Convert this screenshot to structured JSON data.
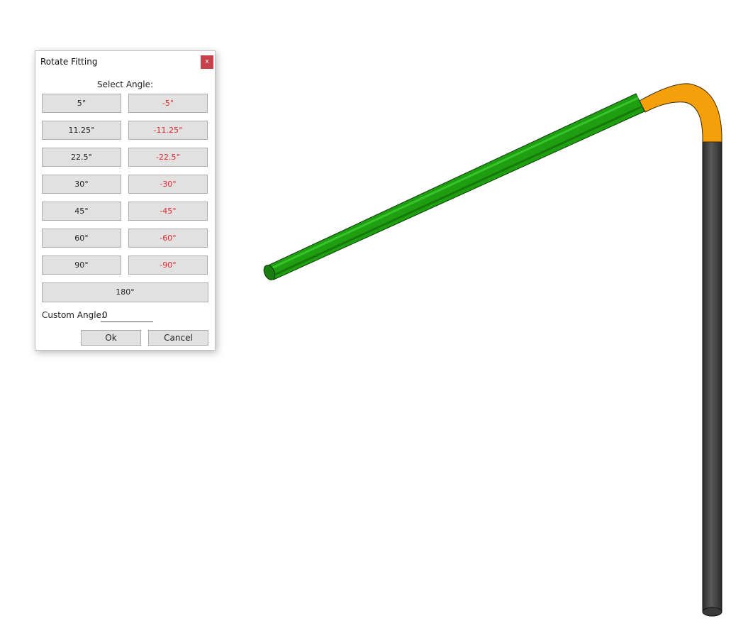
{
  "dialog": {
    "title": "Rotate Fitting",
    "close_label": "x",
    "select_label": "Select Angle:",
    "angles": [
      {
        "pos": "5°",
        "neg": "-5°"
      },
      {
        "pos": "11.25°",
        "neg": "-11.25°"
      },
      {
        "pos": "22.5°",
        "neg": "-22.5°"
      },
      {
        "pos": "30°",
        "neg": "-30°"
      },
      {
        "pos": "45°",
        "neg": "-45°"
      },
      {
        "pos": "60°",
        "neg": "-60°"
      },
      {
        "pos": "90°",
        "neg": "-90°"
      }
    ],
    "angle_180": "180°",
    "custom_label": "Custom Angle:",
    "custom_value": "0",
    "ok_label": "Ok",
    "cancel_label": "Cancel"
  },
  "colors": {
    "close_button": "#c9424b",
    "negative_angle_text": "#e8262d",
    "pipe_green": "#1f9e12",
    "elbow_orange": "#f5a00b",
    "pipe_gray": "#4a4a4a"
  },
  "viewport": {
    "model": "pipe-run",
    "icons": [
      "green-pipe",
      "orange-elbow-fitting",
      "gray-vertical-pipe"
    ]
  }
}
